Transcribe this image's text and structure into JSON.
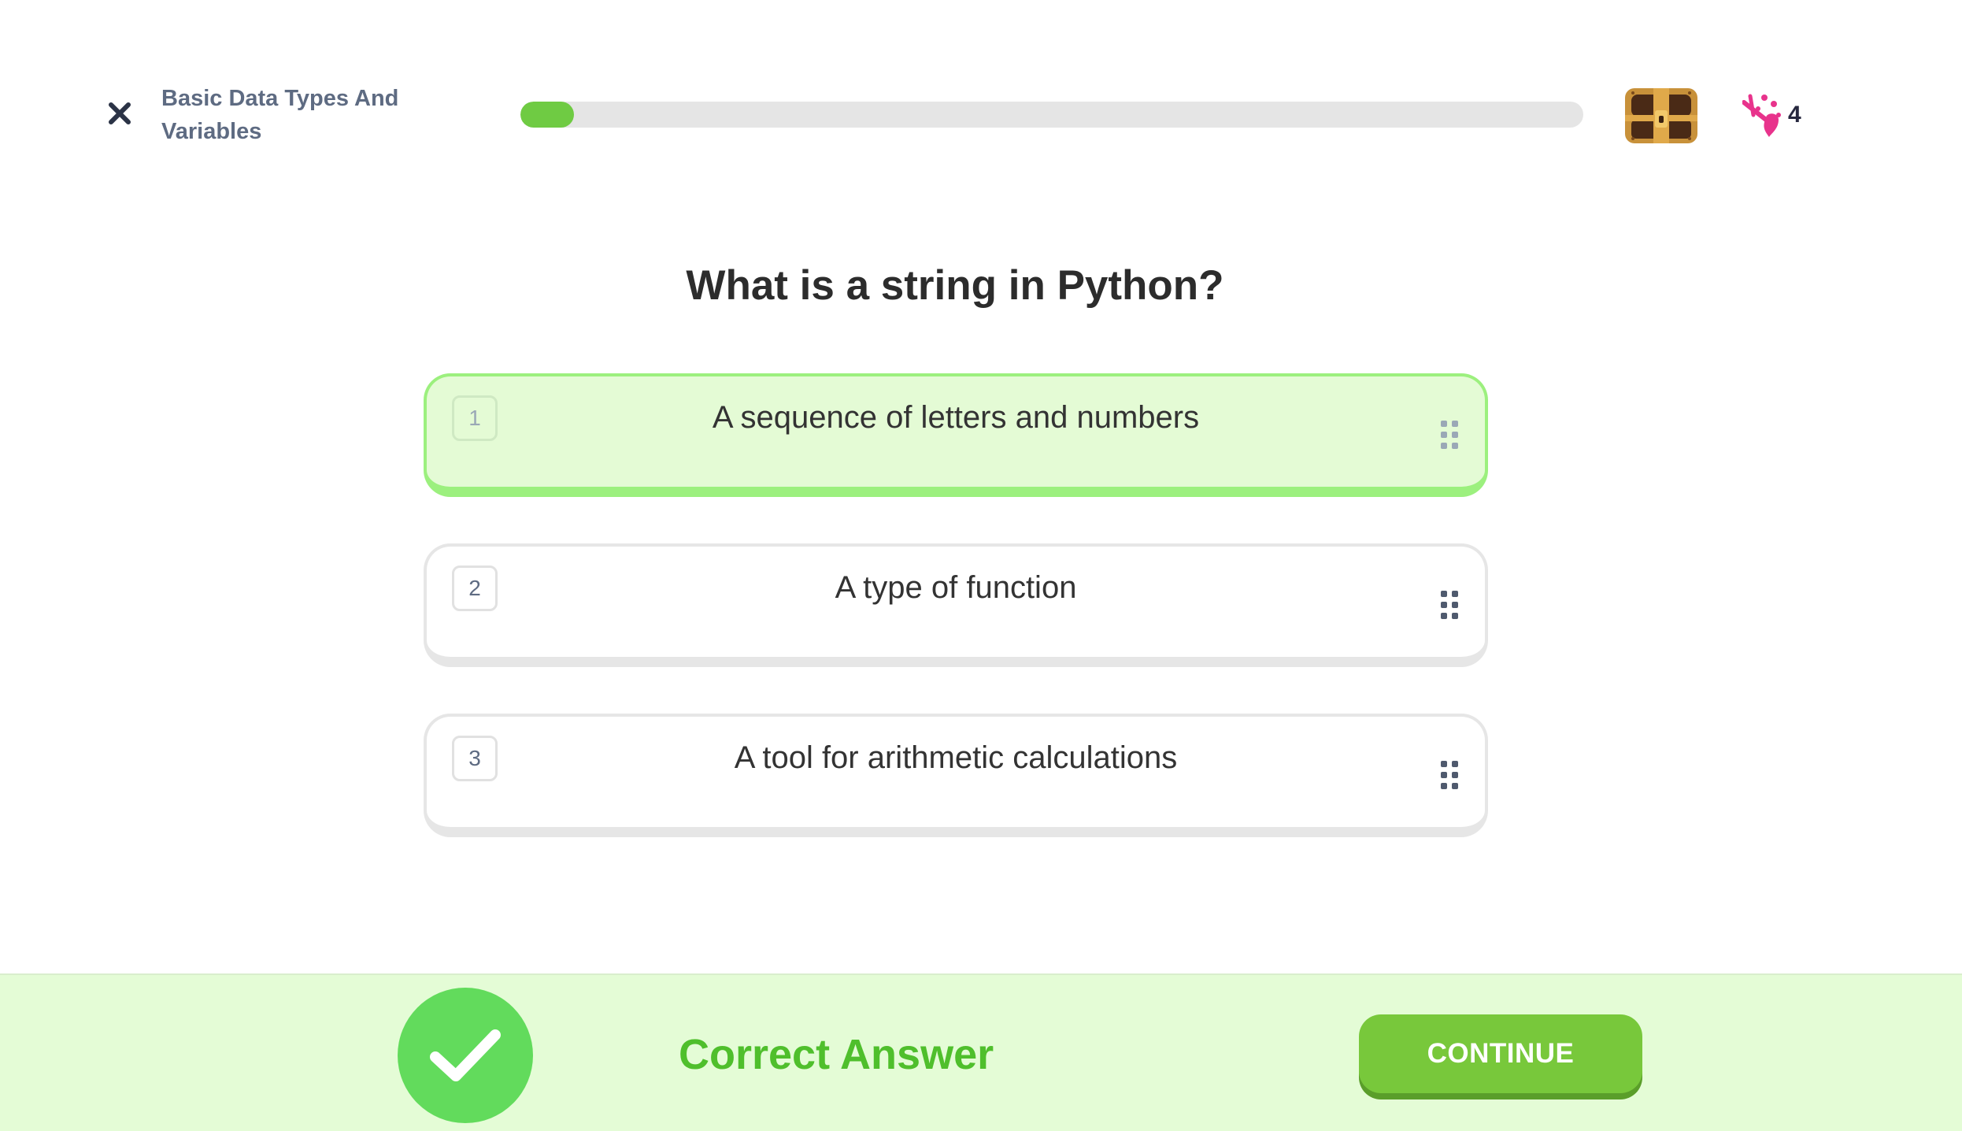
{
  "header": {
    "lesson_title": "Basic Data Types And Variables",
    "progress_fraction": 0.05,
    "streak_count": "4",
    "icons": {
      "close": "close-icon",
      "chest": "treasure-chest-icon",
      "streak": "pink-sparkle-icon"
    }
  },
  "question": {
    "text": "What is a string in Python?",
    "options": [
      {
        "number": "1",
        "text": "A sequence of letters and numbers",
        "selected": true
      },
      {
        "number": "2",
        "text": "A type of function",
        "selected": false
      },
      {
        "number": "3",
        "text": "A tool for arithmetic calculations",
        "selected": false
      }
    ]
  },
  "feedback": {
    "result_text": "Correct Answer",
    "continue_label": "CONTINUE",
    "icon": "checkmark-icon"
  },
  "colors": {
    "accent_green": "#78c83b",
    "correct_text": "#4fbf2c",
    "selected_bg": "#e4fbd5",
    "footer_bg": "#e4fcd6"
  }
}
